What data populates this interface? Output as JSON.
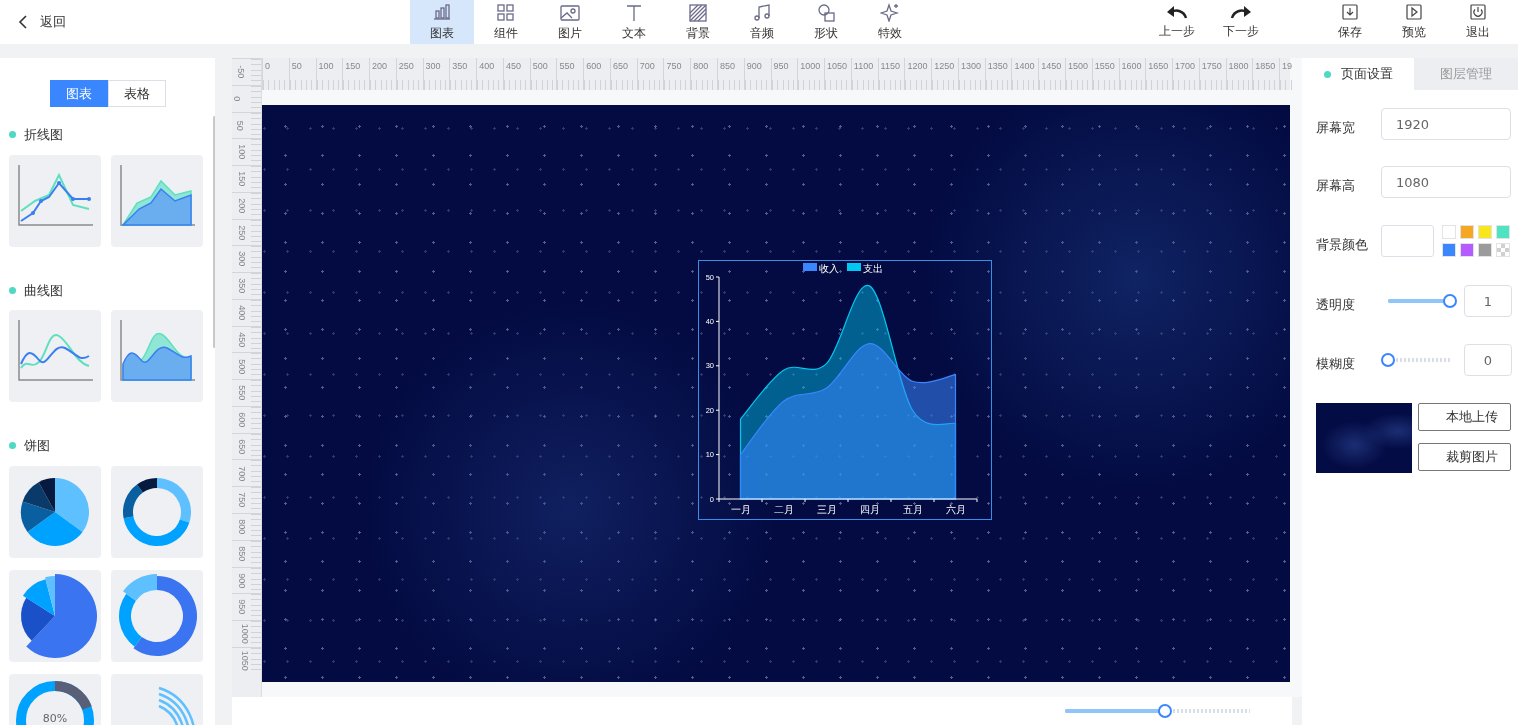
{
  "topbar": {
    "back_label": "返回",
    "tool_tabs": [
      {
        "label": "图表",
        "selected": true
      },
      {
        "label": "组件",
        "selected": false
      },
      {
        "label": "图片",
        "selected": false
      },
      {
        "label": "文本",
        "selected": false
      },
      {
        "label": "背景",
        "selected": false
      },
      {
        "label": "音频",
        "selected": false
      },
      {
        "label": "形状",
        "selected": false
      },
      {
        "label": "特效",
        "selected": false
      }
    ],
    "history_buttons": [
      "上一步",
      "下一步"
    ],
    "file_actions": [
      "保存",
      "预览",
      "退出"
    ]
  },
  "left_panel": {
    "mode_tabs": [
      {
        "label": "图表",
        "selected": true
      },
      {
        "label": "表格",
        "selected": false
      }
    ],
    "sections": [
      {
        "title": "折线图",
        "templates": [
          {
            "kind": "line"
          },
          {
            "kind": "line-area"
          }
        ]
      },
      {
        "title": "曲线图",
        "templates": [
          {
            "kind": "curve"
          },
          {
            "kind": "curve-area"
          }
        ]
      },
      {
        "title": "饼图",
        "templates": [
          {
            "kind": "pie"
          },
          {
            "kind": "donut"
          },
          {
            "kind": "rose-pie"
          },
          {
            "kind": "rose-donut"
          },
          {
            "kind": "gauge",
            "label": "80%"
          },
          {
            "kind": "rings"
          }
        ]
      }
    ]
  },
  "rulers": {
    "top_labels": [
      "0",
      "50",
      "100",
      "150",
      "200",
      "250",
      "300",
      "350",
      "400",
      "450",
      "500",
      "550",
      "600",
      "650",
      "700",
      "750",
      "800",
      "850",
      "900",
      "950",
      "1000",
      "1050",
      "1100",
      "1150",
      "1200",
      "1250",
      "1300",
      "1350",
      "1400",
      "1450",
      "1500",
      "1550",
      "1600",
      "1650",
      "1700",
      "1750",
      "1800",
      "1850",
      "19"
    ],
    "left_labels": [
      "-50",
      "0",
      "50",
      "100",
      "150",
      "200",
      "250",
      "300",
      "350",
      "400",
      "450",
      "500",
      "550",
      "600",
      "650",
      "700",
      "750",
      "800",
      "850",
      "900",
      "950",
      "1000",
      "1050"
    ]
  },
  "canvas": {
    "chart": {
      "chart_data": {
        "type": "area",
        "categories": [
          "一月",
          "二月",
          "三月",
          "四月",
          "五月",
          "六月"
        ],
        "series": [
          {
            "name": "收入",
            "color": "#3a86ff",
            "values": [
              10,
              22,
              25,
              35,
              26.5,
              28
            ]
          },
          {
            "name": "支出",
            "color": "#00c8f0",
            "values": [
              18,
              29,
              30.5,
              48,
              20,
              17
            ]
          }
        ],
        "legend": "top",
        "ylim": [
          0,
          50
        ],
        "yticks": [
          0,
          10,
          20,
          30,
          40,
          50
        ]
      }
    }
  },
  "zoom_slider": {
    "level": 0.54
  },
  "right_panel": {
    "tabs": [
      {
        "label": "页面设置",
        "selected": true
      },
      {
        "label": "图层管理",
        "selected": false
      }
    ],
    "screen_width": {
      "label": "屏幕宽",
      "value": "1920"
    },
    "screen_height": {
      "label": "屏幕高",
      "value": "1080"
    },
    "background_color": {
      "label": "背景颜色",
      "swatches": [
        {
          "kind": "solid",
          "color": "#ffffff"
        },
        {
          "kind": "solid",
          "color": "#f5a623"
        },
        {
          "kind": "solid",
          "color": "#f8e71c"
        },
        {
          "kind": "solid",
          "color": "#50e3c2"
        },
        {
          "kind": "solid",
          "color": "#3a86ff"
        },
        {
          "kind": "solid",
          "color": "#b45cff"
        },
        {
          "kind": "solid",
          "color": "#9b9b9b"
        },
        {
          "kind": "transparent"
        }
      ]
    },
    "opacity": {
      "label": "透明度",
      "level": 1,
      "value": "1"
    },
    "blur": {
      "label": "模糊度",
      "level": 0,
      "value": "0"
    },
    "buttons": [
      "本地上传",
      "裁剪图片"
    ]
  }
}
